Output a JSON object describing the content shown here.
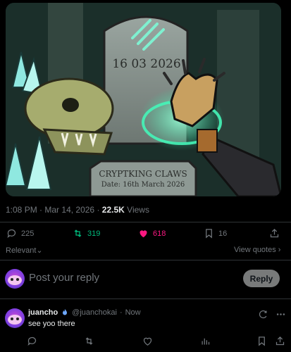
{
  "media": {
    "stone_date": "16 03 2026",
    "plaque_title": "CRYPTKING CLAWS",
    "plaque_date": "Date: 16th March 2026"
  },
  "meta": {
    "time": "1:08 PM",
    "date": "Mar 14, 2026",
    "separator": "·",
    "views_count": "22.5K",
    "views_label": "Views"
  },
  "actions": {
    "replies": "225",
    "retweets": "319",
    "likes": "618",
    "bookmarks": "16"
  },
  "sort": {
    "relevant_label": "Relevant",
    "view_quotes_label": "View quotes"
  },
  "composer": {
    "placeholder": "Post your reply",
    "reply_button": "Reply"
  },
  "reply": {
    "name": "juancho",
    "handle": "@juanchokai",
    "separator": "·",
    "time": "Now",
    "text": "see yoo there"
  },
  "colors": {
    "like": "#f91880",
    "retweet": "#00ba7c",
    "muted": "#71767b"
  },
  "icons": {
    "reply": "chat-bubble-icon",
    "retweet": "retweet-icon",
    "like": "heart-icon",
    "bookmark": "bookmark-icon",
    "share": "share-icon",
    "analytics": "bar-chart-icon",
    "verified": "flame-badge-icon",
    "grok": "grok-icon"
  }
}
